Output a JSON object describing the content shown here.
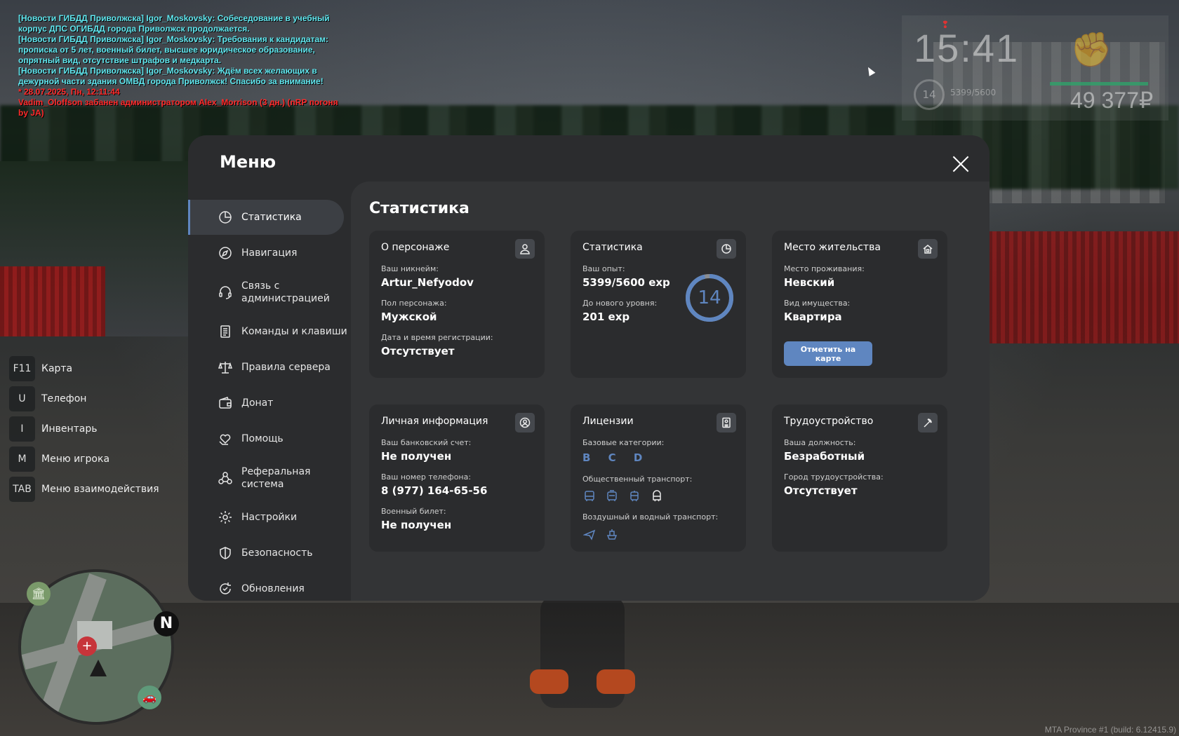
{
  "chat": [
    {
      "text": "[Новости ГИБДД Приволжска] Igor_Moskovsky: Собеседование в учебный корпус ДПС ОГИБДД города Приволжск продолжается.",
      "color": "cyan"
    },
    {
      "text": "[Новости ГИБДД Приволжска] Igor_Moskovsky: Требования к кандидатам: прописка от 5 лет, военный билет, высшее юридическое образование, опрятный вид, отсутствие штрафов и медкарта.",
      "color": "cyan"
    },
    {
      "text": "[Новости ГИБДД Приволжска] Igor_Moskovsky: Ждём всех желающих в дежурной части здания ОМВД города Приволжск! Спасибо за внимание!",
      "color": "cyan"
    },
    {
      "text": "* 28.07.2025, Пн, 12:11:44",
      "color": "red"
    },
    {
      "text": "Vadim_Oloffson забанен администратором Alex_Morrison (3 дн.) (nRP погоня by JA)",
      "color": "red"
    }
  ],
  "hud": {
    "time": "15:41",
    "level": "14",
    "exp": "5399/5600",
    "money": "49 377₽",
    "fist_icon": "fist-icon",
    "health_fraction": 0.93
  },
  "hotkeys": [
    {
      "key": "F11",
      "label": "Карта"
    },
    {
      "key": "U",
      "label": "Телефон"
    },
    {
      "key": "I",
      "label": "Инвентарь"
    },
    {
      "key": "M",
      "label": "Меню игрока"
    },
    {
      "key": "TAB",
      "label": "Меню взаимодействия"
    }
  ],
  "minimap": {
    "north": "N"
  },
  "menu": {
    "title": "Меню",
    "nav": [
      {
        "label": "Статистика",
        "icon": "pie-chart-icon",
        "active": true
      },
      {
        "label": "Навигация",
        "icon": "compass-icon"
      },
      {
        "label": "Связь с администрацией",
        "icon": "headset-icon"
      },
      {
        "label": "Команды и клавиши",
        "icon": "document-icon"
      },
      {
        "label": "Правила сервера",
        "icon": "scales-icon"
      },
      {
        "label": "Донат",
        "icon": "wallet-icon"
      },
      {
        "label": "Помощь",
        "icon": "heart-hand-icon"
      },
      {
        "label": "Реферальная система",
        "icon": "network-icon"
      },
      {
        "label": "Настройки",
        "icon": "gear-icon"
      },
      {
        "label": "Безопасность",
        "icon": "shield-icon"
      },
      {
        "label": "Обновления",
        "icon": "refresh-check-icon"
      }
    ]
  },
  "content": {
    "title": "Статистика",
    "character": {
      "title": "О персонаже",
      "nickname_label": "Ваш никнейм:",
      "nickname": "Artur_Nefyodov",
      "gender_label": "Пол персонажа:",
      "gender": "Мужской",
      "reg_label": "Дата и время регистрации:",
      "reg": "Отсутствует"
    },
    "stats": {
      "title": "Статистика",
      "exp_label": "Ваш опыт:",
      "exp": "5399/5600 exp",
      "next_label": "До нового уровня:",
      "next": "201 exp",
      "level": "14",
      "progress": 0.964
    },
    "residence": {
      "title": "Место жительства",
      "place_label": "Место проживания:",
      "place": "Невский",
      "property_label": "Вид имущества:",
      "property": "Квартира",
      "button": "Отметить на карте"
    },
    "personal": {
      "title": "Личная информация",
      "bank_label": "Ваш банковский счет:",
      "bank": "Не получен",
      "phone_label": "Ваш номер телефона:",
      "phone": "8 (977) 164-65-56",
      "military_label": "Военный билет:",
      "military": "Не получен"
    },
    "licenses": {
      "title": "Лицензии",
      "basic_label": "Базовые категории:",
      "basic": "B C D",
      "public_label": "Общественный транспорт:",
      "public_icons": [
        "bus-icon",
        "trolleybus-icon",
        "tram-icon",
        "metro-icon"
      ],
      "air_label": "Воздушный и водный транспорт:",
      "air_icons": [
        "plane-icon",
        "boat-icon"
      ]
    },
    "employment": {
      "title": "Трудоустройство",
      "position_label": "Ваша должность:",
      "position": "Безработный",
      "city_label": "Город трудоустройства:",
      "city": "Отсутствует"
    }
  },
  "build": "MTA Province #1 (build: 6.12415.9)"
}
